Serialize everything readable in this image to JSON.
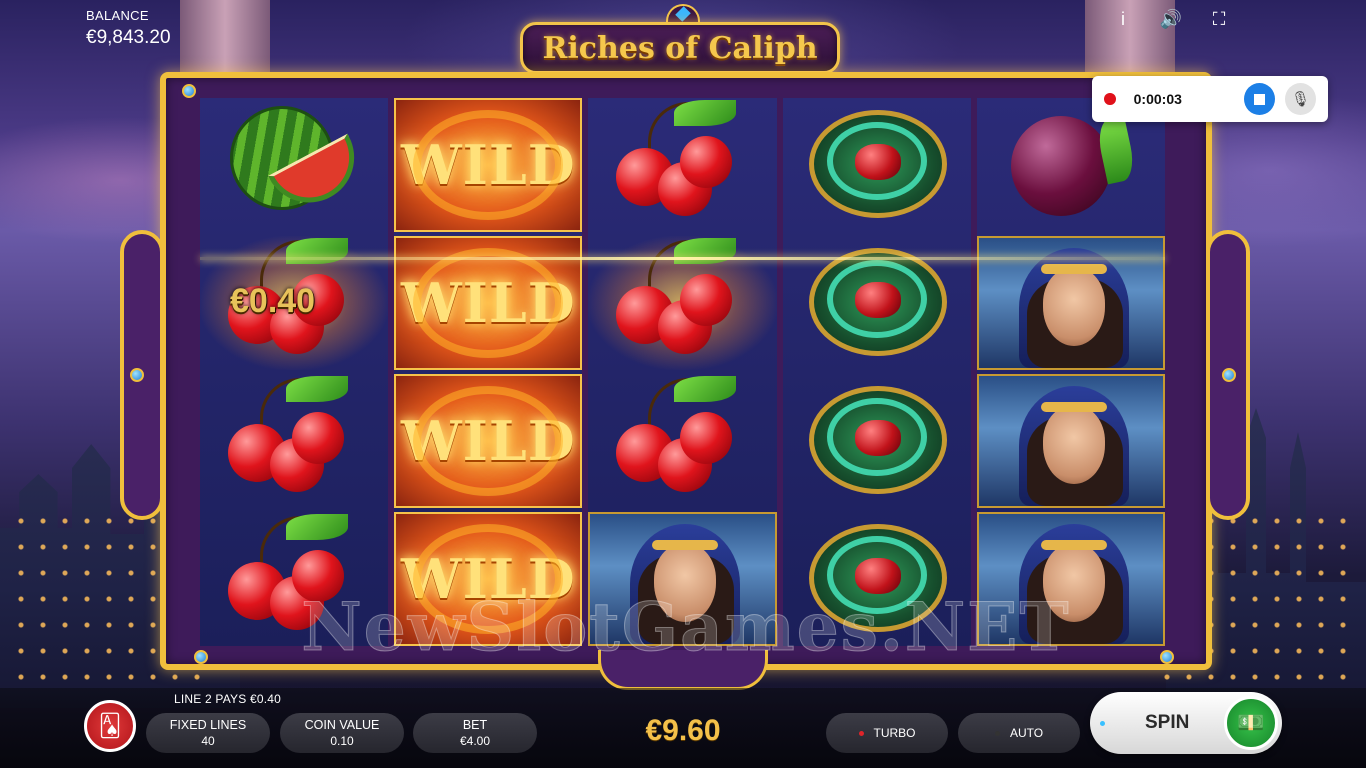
{
  "game": {
    "title": "Riches of Caliph",
    "watermark": "NewSlotGames.NET"
  },
  "balance": {
    "label": "BALANCE",
    "value": "€9,843.20"
  },
  "top_icons": [
    {
      "name": "info-icon",
      "glyph": "i"
    },
    {
      "name": "sound-icon",
      "glyph": "🔊"
    },
    {
      "name": "fullscreen-icon",
      "glyph": "⛶"
    }
  ],
  "recorder": {
    "time": "0:00:03",
    "mic_glyph": "🎙"
  },
  "reels": {
    "win_amount": "€0.40",
    "wild_label": "WILD",
    "symbols": [
      [
        "watermelon",
        "cherry",
        "cherry",
        "cherry"
      ],
      [
        "wild",
        "wild",
        "wild",
        "wild"
      ],
      [
        "cherry",
        "cherry",
        "cherry",
        "princess"
      ],
      [
        "emblem",
        "emblem",
        "emblem",
        "emblem"
      ],
      [
        "plum",
        "princess",
        "princess",
        "princess"
      ]
    ]
  },
  "bottom_bar": {
    "win_message": "LINE 2 PAYS €0.40",
    "cards_glyph": "🂡",
    "fixed_lines": {
      "label": "FIXED LINES",
      "value": "40"
    },
    "coin_value": {
      "label": "COIN VALUE",
      "value": "0.10"
    },
    "bet": {
      "label": "BET",
      "value": "€4.00"
    },
    "total_bet": "€9.60",
    "turbo_label": "TURBO",
    "auto_label": "AUTO",
    "spin_label": "SPIN",
    "spin_glyph": "💵"
  },
  "colors": {
    "gold": "#f0bf3c",
    "turbo_dot": "#e0242a",
    "auto_dot": "#333333",
    "spin_dot": "#39c0ff",
    "total_bet": "#f4c04a"
  }
}
